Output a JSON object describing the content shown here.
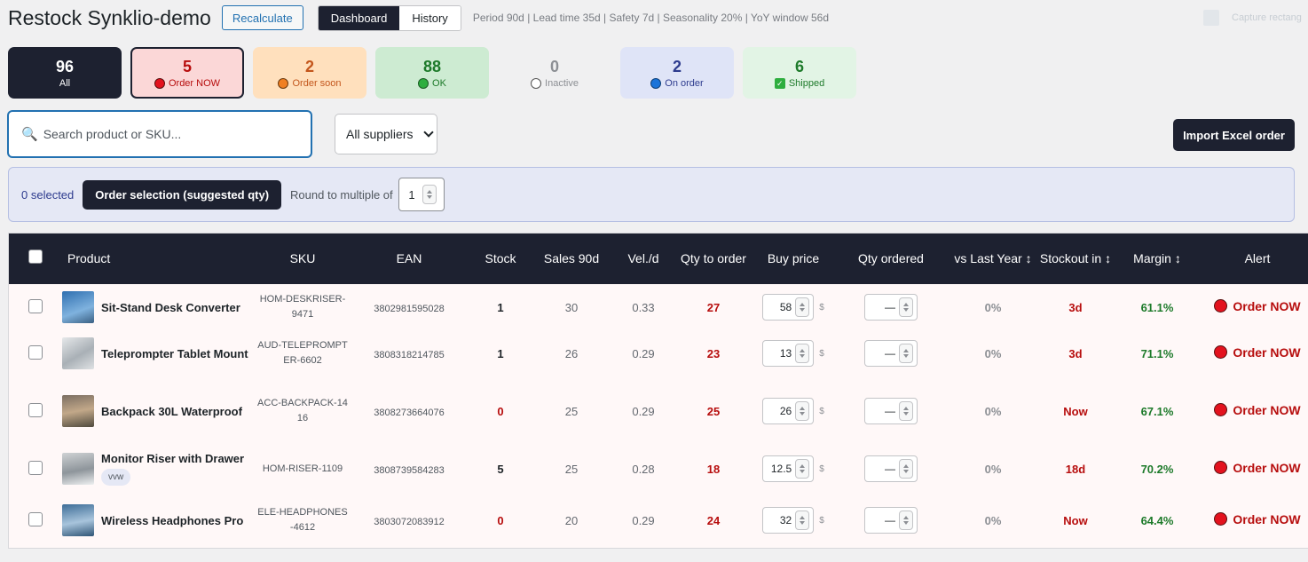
{
  "header": {
    "title": "Restock Synklio-demo",
    "recalculate_label": "Recalculate",
    "tabs": [
      {
        "label": "Dashboard",
        "active": true
      },
      {
        "label": "History",
        "active": false
      }
    ],
    "params": "Period 90d | Lead time 35d | Safety 7d | Seasonality 20% | YoY window 56d",
    "capture_label": "Capture rectang"
  },
  "cards": [
    {
      "count": "96",
      "label": "All",
      "icon": "none"
    },
    {
      "count": "5",
      "label": "Order NOW",
      "icon": "red-dot-icon"
    },
    {
      "count": "2",
      "label": "Order soon",
      "icon": "orange-dot-icon"
    },
    {
      "count": "88",
      "label": "OK",
      "icon": "green-dot-icon"
    },
    {
      "count": "0",
      "label": "Inactive",
      "icon": "empty-circle-icon"
    },
    {
      "count": "2",
      "label": "On order",
      "icon": "blue-dot-icon"
    },
    {
      "count": "6",
      "label": "Shipped",
      "icon": "checkbox-icon"
    }
  ],
  "toolbar": {
    "search_placeholder": "Search product or SKU...",
    "supplier_filter": "All suppliers",
    "import_label": "Import Excel order"
  },
  "selection": {
    "count_text": "0 selected",
    "order_button": "Order selection (suggested qty)",
    "round_label": "Round to multiple of",
    "round_value": "1"
  },
  "table": {
    "columns": [
      "Product",
      "SKU",
      "EAN",
      "Stock",
      "Sales 90d",
      "Vel./d",
      "Qty to order",
      "Buy price",
      "Qty ordered",
      "vs Last Year ↕",
      "Stockout in ↕",
      "Margin ↕",
      "Alert"
    ],
    "rows": [
      {
        "product": "Sit-Stand Desk Converter",
        "tag": "",
        "sku": "HOM-DESKRISER-9471",
        "ean": "3802981595028",
        "stock": "1",
        "sales": "30",
        "vel": "0.33",
        "qty_to_order": "27",
        "buy_price": "58",
        "currency": "$",
        "qty_ordered": "—",
        "vs_ly": "0%",
        "stockout": "3d",
        "margin": "61.1%",
        "alert": "Order NOW"
      },
      {
        "product": "Teleprompter Tablet Mount",
        "tag": "",
        "sku": "AUD-TELEPROMPTER-6602",
        "ean": "3808318214785",
        "stock": "1",
        "sales": "26",
        "vel": "0.29",
        "qty_to_order": "23",
        "buy_price": "13",
        "currency": "$",
        "qty_ordered": "—",
        "vs_ly": "0%",
        "stockout": "3d",
        "margin": "71.1%",
        "alert": "Order NOW"
      },
      {
        "product": "Backpack 30L Waterproof",
        "tag": "",
        "sku": "ACC-BACKPACK-1416",
        "ean": "3808273664076",
        "stock": "0",
        "sales": "25",
        "vel": "0.29",
        "qty_to_order": "25",
        "buy_price": "26",
        "currency": "$",
        "qty_ordered": "—",
        "vs_ly": "0%",
        "stockout": "Now",
        "margin": "67.1%",
        "alert": "Order NOW"
      },
      {
        "product": "Monitor Riser with Drawer",
        "tag": "vvw",
        "sku": "HOM-RISER-1109",
        "ean": "3808739584283",
        "stock": "5",
        "sales": "25",
        "vel": "0.28",
        "qty_to_order": "18",
        "buy_price": "12.5",
        "currency": "$",
        "qty_ordered": "—",
        "vs_ly": "0%",
        "stockout": "18d",
        "margin": "70.2%",
        "alert": "Order NOW"
      },
      {
        "product": "Wireless Headphones Pro",
        "tag": "",
        "sku": "ELE-HEADPHONES-4612",
        "ean": "3803072083912",
        "stock": "0",
        "sales": "20",
        "vel": "0.29",
        "qty_to_order": "24",
        "buy_price": "32",
        "currency": "$",
        "qty_ordered": "—",
        "vs_ly": "0%",
        "stockout": "Now",
        "margin": "64.4%",
        "alert": "Order NOW"
      }
    ]
  },
  "colors": {
    "dark": "#1d2130",
    "accent_blue": "#2271b1",
    "order_now_red": "#b70d0d",
    "ok_green": "#1d7a2a"
  }
}
